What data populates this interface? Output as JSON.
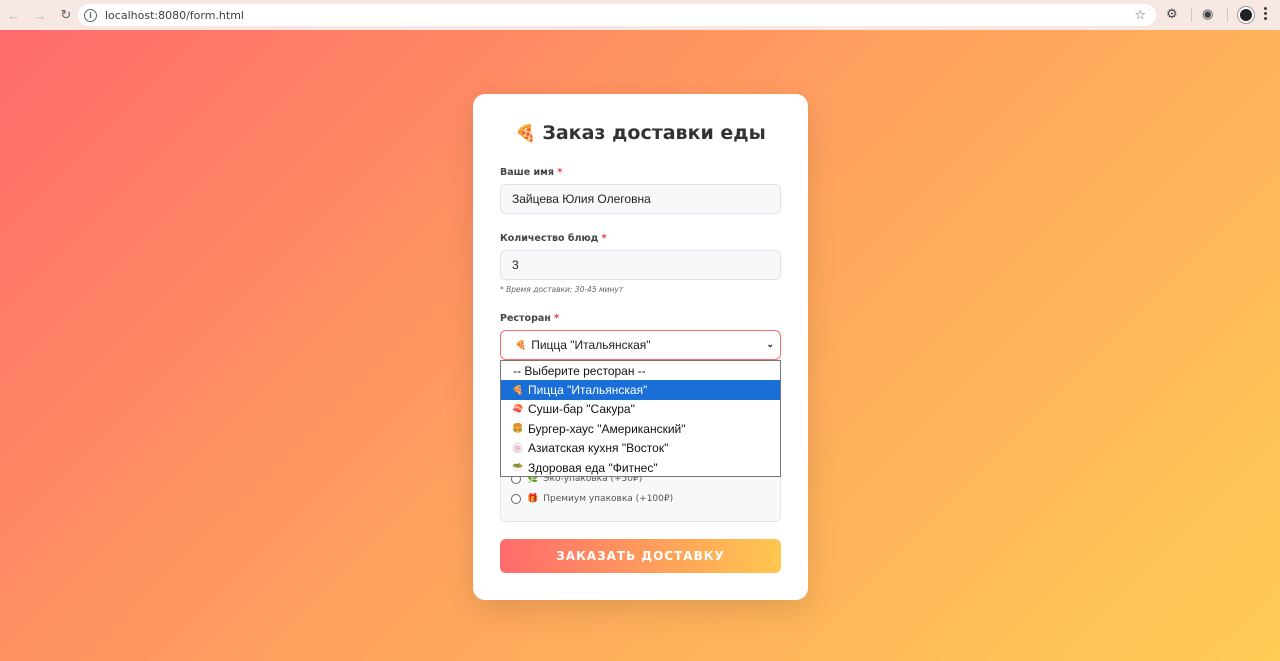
{
  "browser": {
    "url": "localhost:8080/form.html"
  },
  "form": {
    "title": "Заказ доставки еды",
    "title_icon": "🍕",
    "name_label": "Ваше имя",
    "name_value": "Зайцева Юлия Олеговна",
    "qty_label": "Количество блюд",
    "qty_value": "3",
    "hint": "* Время доставки: 30-45 минут",
    "restaurant_label": "Ресторан",
    "required_mark": "*",
    "restaurant_selected_icon": "🍕",
    "restaurant_selected": "Пицца \"Итальянская\"",
    "restaurant_options": [
      {
        "icon": "",
        "label": "-- Выберите ресторан --"
      },
      {
        "icon": "🍕",
        "label": "Пицца \"Итальянская\""
      },
      {
        "icon": "🍣",
        "label": "Суши-бар \"Сакура\""
      },
      {
        "icon": "🍔",
        "label": "Бургер-хаус \"Американский\""
      },
      {
        "icon": "🍥",
        "label": "Азиатская кухня \"Восток\""
      },
      {
        "icon": "🥗",
        "label": "Здоровая еда \"Фитнес\""
      }
    ],
    "packaging": [
      {
        "icon": "🌿",
        "label": "Эко-упаковка (+50₽)"
      },
      {
        "icon": "🎁",
        "label": "Премиум упаковка (+100₽)"
      }
    ],
    "submit_label": "ЗАКАЗАТЬ ДОСТАВКУ"
  },
  "colors": {
    "accent": "#ff6b6b",
    "accent_end": "#ffc74f",
    "selected_option": "#1a6ed8"
  }
}
